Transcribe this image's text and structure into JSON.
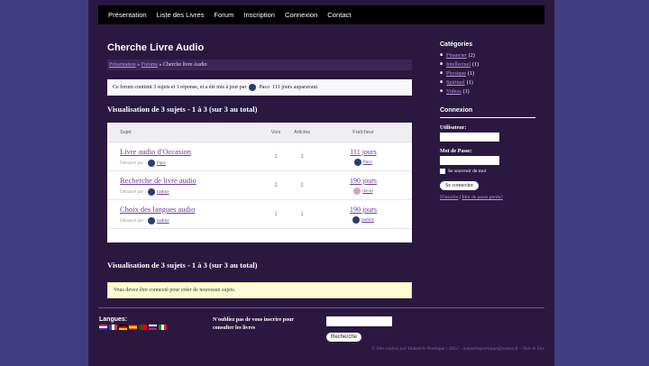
{
  "nav": [
    "Présentation",
    "Liste des Livres",
    "Forum",
    "Inscription",
    "Connexion",
    "Contact"
  ],
  "page_title": "Cherche Livre Audio",
  "breadcrumb": {
    "home": "Présentation",
    "sep": "»",
    "forums": "Forums",
    "current": "Cherche livre Audio"
  },
  "info": {
    "text_before": "Ce forum contient 3 sujets et 1 réponse, et a été mis à jour par",
    "user": "Paco",
    "time": "111 jours auparavant."
  },
  "viewing_title": "Visualisation de 3 sujets - 1 à 3 (sur 3 au total)",
  "table": {
    "headers": {
      "subject": "Sujet",
      "views": "Voix",
      "posts": "Articles",
      "freshness": "Fraîcheur"
    },
    "started_by": "Démarré par :",
    "rows": [
      {
        "title": "Livre audio d'Occasion",
        "author": "Paco",
        "voices": "1",
        "posts": "1",
        "fresh": "111 jours",
        "fresh_user": "Paco"
      },
      {
        "title": "Recherche de livre audio",
        "author": "nadine",
        "voices": "2",
        "posts": "2",
        "fresh": "190 jours",
        "fresh_user": "david"
      },
      {
        "title": "Choix des langues audio",
        "author": "nadine",
        "voices": "1",
        "posts": "1",
        "fresh": "190 jours",
        "fresh_user": "nadine"
      }
    ]
  },
  "notice": "Vous devez être connecté pour créer de nouveaux sujets.",
  "sidebar": {
    "categories_title": "Catégories",
    "categories": [
      {
        "name": "Financier",
        "count": "(2)"
      },
      {
        "name": "Intellectuel",
        "count": "(1)"
      },
      {
        "name": "Physique",
        "count": "(1)"
      },
      {
        "name": "Spirituel",
        "count": "(1)"
      },
      {
        "name": "Videos",
        "count": "(1)"
      }
    ],
    "login_title": "Connexion",
    "user_label": "Utilisateur:",
    "pass_label": "Mot de Passe:",
    "remember": "Se souvenir de moi",
    "login_button": "Se connecter",
    "register": "S'inscrire",
    "link_sep": "|",
    "forgot": "Mot de passe perdu?"
  },
  "footer": {
    "lang_label": "Langues:",
    "note": "N'oubliez pas de vous inscrire pour consulter les livres",
    "search_button": "Recherche",
    "credit": "© Site réalisé par Industrie Poetique | 2012 - industriepoetique@yahoo.fr - Voir le Site"
  },
  "colors": {
    "background": "#3f3d80",
    "page": "#2a1840",
    "link": "#6b3c95",
    "sidebar_link": "#b79be0"
  }
}
